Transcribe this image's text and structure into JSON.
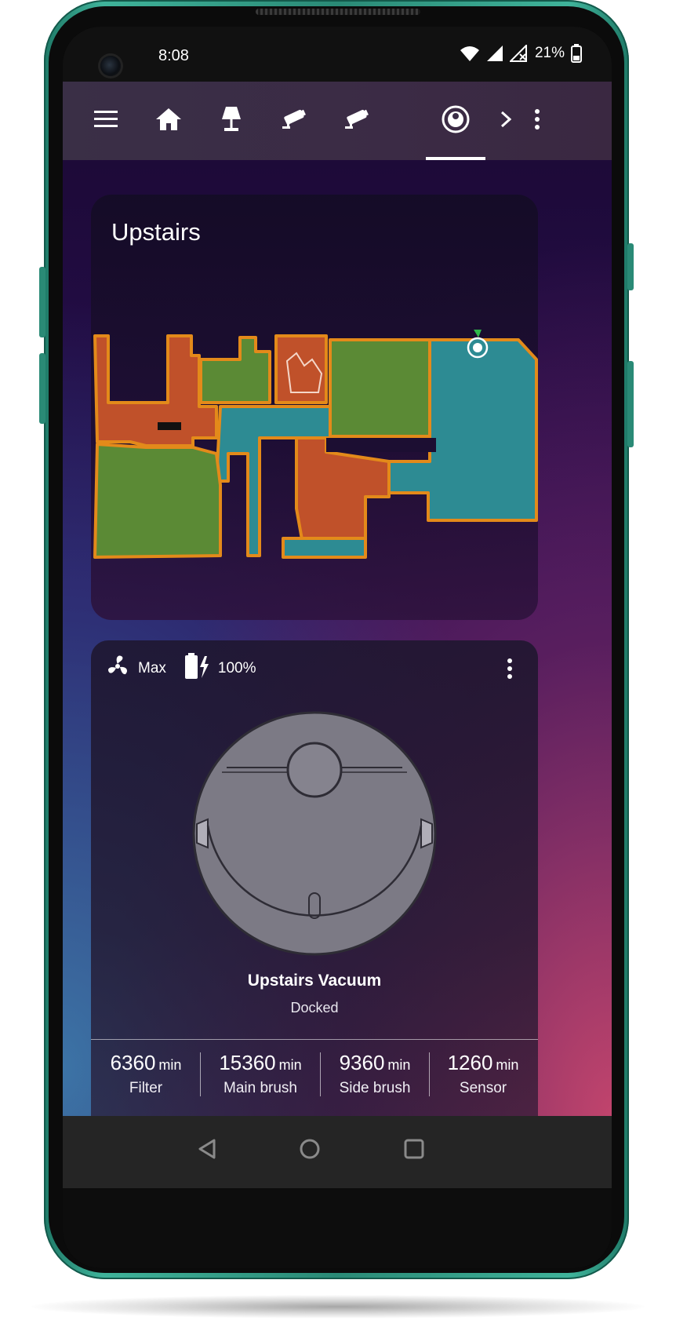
{
  "status_bar": {
    "time": "8:08",
    "battery_percent": "21%",
    "icons": [
      "wifi-icon",
      "cell-signal-icon",
      "no-signal-icon",
      "battery-icon"
    ]
  },
  "app_bar": {
    "tabs": [
      {
        "icon": "menu-icon"
      },
      {
        "icon": "home-icon"
      },
      {
        "icon": "lamp-icon"
      },
      {
        "icon": "security-camera-icon"
      },
      {
        "icon": "security-camera-icon"
      },
      {
        "icon": "robot-vacuum-icon",
        "selected": true
      },
      {
        "icon": "chevron-right-icon"
      },
      {
        "icon": "more-vert-icon"
      }
    ]
  },
  "map_card": {
    "title": "Upstairs",
    "room_colors": {
      "orange": "#c0512a",
      "green": "#5b8a35",
      "teal": "#2d8b93",
      "outline": "#e38a1a"
    }
  },
  "vacuum_card": {
    "fan_speed": "Max",
    "battery": "100%",
    "name": "Upstairs Vacuum",
    "state": "Docked",
    "stats": [
      {
        "value": "6360",
        "unit": "min",
        "label": "Filter"
      },
      {
        "value": "15360",
        "unit": "min",
        "label": "Main brush"
      },
      {
        "value": "9360",
        "unit": "min",
        "label": "Side brush"
      },
      {
        "value": "1260",
        "unit": "min",
        "label": "Sensor"
      }
    ]
  },
  "nav_bar": {
    "buttons": [
      "back-icon",
      "home-circle-icon",
      "recents-icon"
    ]
  }
}
